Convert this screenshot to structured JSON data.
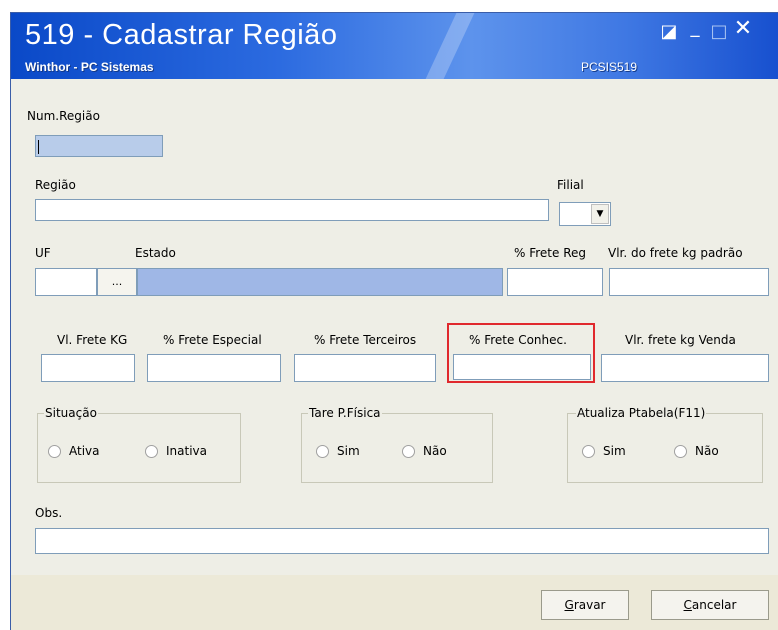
{
  "window": {
    "title": "519 - Cadastrar Região",
    "subtitle": "Winthor - PC Sistemas",
    "code": "PCSIS519",
    "controls": {
      "restore": "◪",
      "minimize": "_",
      "maximize": "□",
      "close": "✕"
    }
  },
  "form": {
    "num_regiao": {
      "label": "Num.Região",
      "value": ""
    },
    "regiao": {
      "label": "Região",
      "value": ""
    },
    "filial": {
      "label": "Filial",
      "value": ""
    },
    "uf": {
      "label": "UF",
      "value": "",
      "lookup_button": "..."
    },
    "estado": {
      "label": "Estado",
      "value": ""
    },
    "frete_reg": {
      "label": "% Frete Reg",
      "value": ""
    },
    "vlr_frete_kg_padrao": {
      "label": "Vlr. do frete kg padrão",
      "value": ""
    },
    "vl_frete_kg": {
      "label": "Vl. Frete KG",
      "value": ""
    },
    "frete_especial": {
      "label": "% Frete Especial",
      "value": ""
    },
    "frete_terceiros": {
      "label": "% Frete Terceiros",
      "value": ""
    },
    "frete_conhec": {
      "label": "% Frete Conhec.",
      "value": ""
    },
    "vlr_frete_kg_venda": {
      "label": "Vlr. frete kg Venda",
      "value": ""
    },
    "situacao": {
      "label": "Situação",
      "options": [
        "Ativa",
        "Inativa"
      ]
    },
    "tare": {
      "label": "Tare P.Física",
      "options": [
        "Sim",
        "Não"
      ]
    },
    "atualiza": {
      "label": "Atualiza Ptabela(F11)",
      "options": [
        "Sim",
        "Não"
      ]
    },
    "obs": {
      "label": "Obs.",
      "value": ""
    }
  },
  "buttons": {
    "gravar_hotkey": "G",
    "gravar_rest": "ravar",
    "cancelar_hotkey": "C",
    "cancelar_rest": "ancelar"
  },
  "colors": {
    "highlight": "#e0282d",
    "titlebar": "#0a49c8"
  }
}
